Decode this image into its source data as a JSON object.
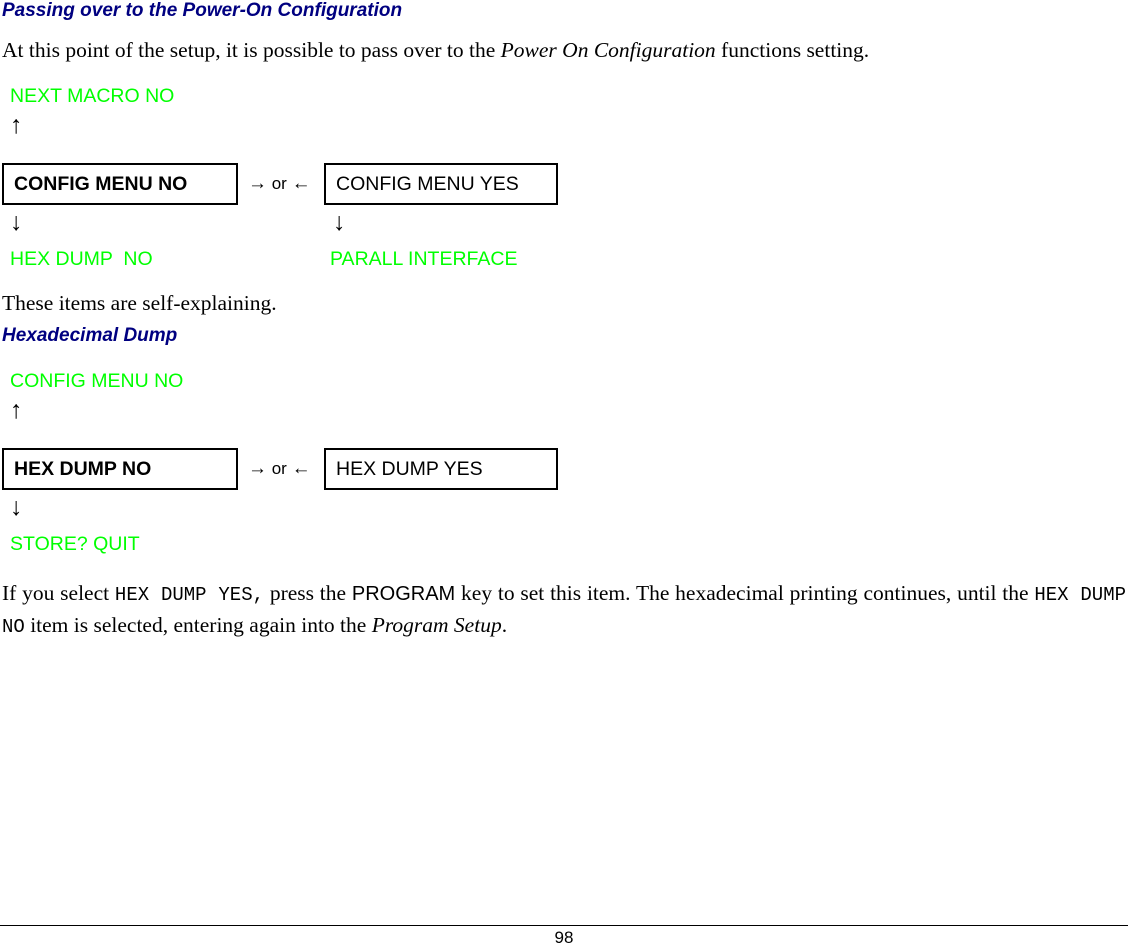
{
  "document": {
    "page_number": "98"
  },
  "sections": {
    "passing_over": {
      "heading": "Passing over to the Power-On Configuration",
      "intro_before_italic": "At this point of the setup, it is possible to pass over to the ",
      "intro_italic": "Power On Configuration",
      "intro_after_italic": " functions setting.",
      "self_explaining": "These items are self-explaining."
    },
    "hexadecimal_dump": {
      "heading": "Hexadecimal Dump",
      "final_p1": "If you select ",
      "final_mono1": "HEX DUMP YES,",
      "final_p2": " press the ",
      "final_sans1": "PROGRAM",
      "final_p3": " key to set this item. The hexadecimal printing continues, until the ",
      "final_mono2": "HEX DUMP NO",
      "final_p4": " item is selected, entering again into the ",
      "final_italic": "Program Setup",
      "final_p5": "."
    }
  },
  "diagrams": [
    {
      "id": "config-menu",
      "top_label": "NEXT MACRO NO",
      "up_arrow": "↑",
      "box_left": "CONFIG MENU NO",
      "connector_arrow_right": "→",
      "connector_or": " or ",
      "connector_arrow_left": "←",
      "box_right": "CONFIG MENU YES",
      "down_arrow_left": "↓",
      "down_arrow_right": "↓",
      "bottom_label_left": "HEX DUMP  NO",
      "bottom_label_right": "PARALL INTERFACE"
    },
    {
      "id": "hex-dump",
      "top_label": "CONFIG MENU NO",
      "up_arrow": "↑",
      "box_left": "HEX DUMP NO",
      "connector_arrow_right": "→",
      "connector_or": " or ",
      "connector_arrow_left": "←",
      "box_right": "HEX DUMP YES",
      "down_arrow_left": "↓",
      "bottom_label_left": "STORE? QUIT"
    }
  ],
  "colors": {
    "heading": "#000080",
    "lcd_text": "#00ff00",
    "body_text": "#000000"
  }
}
